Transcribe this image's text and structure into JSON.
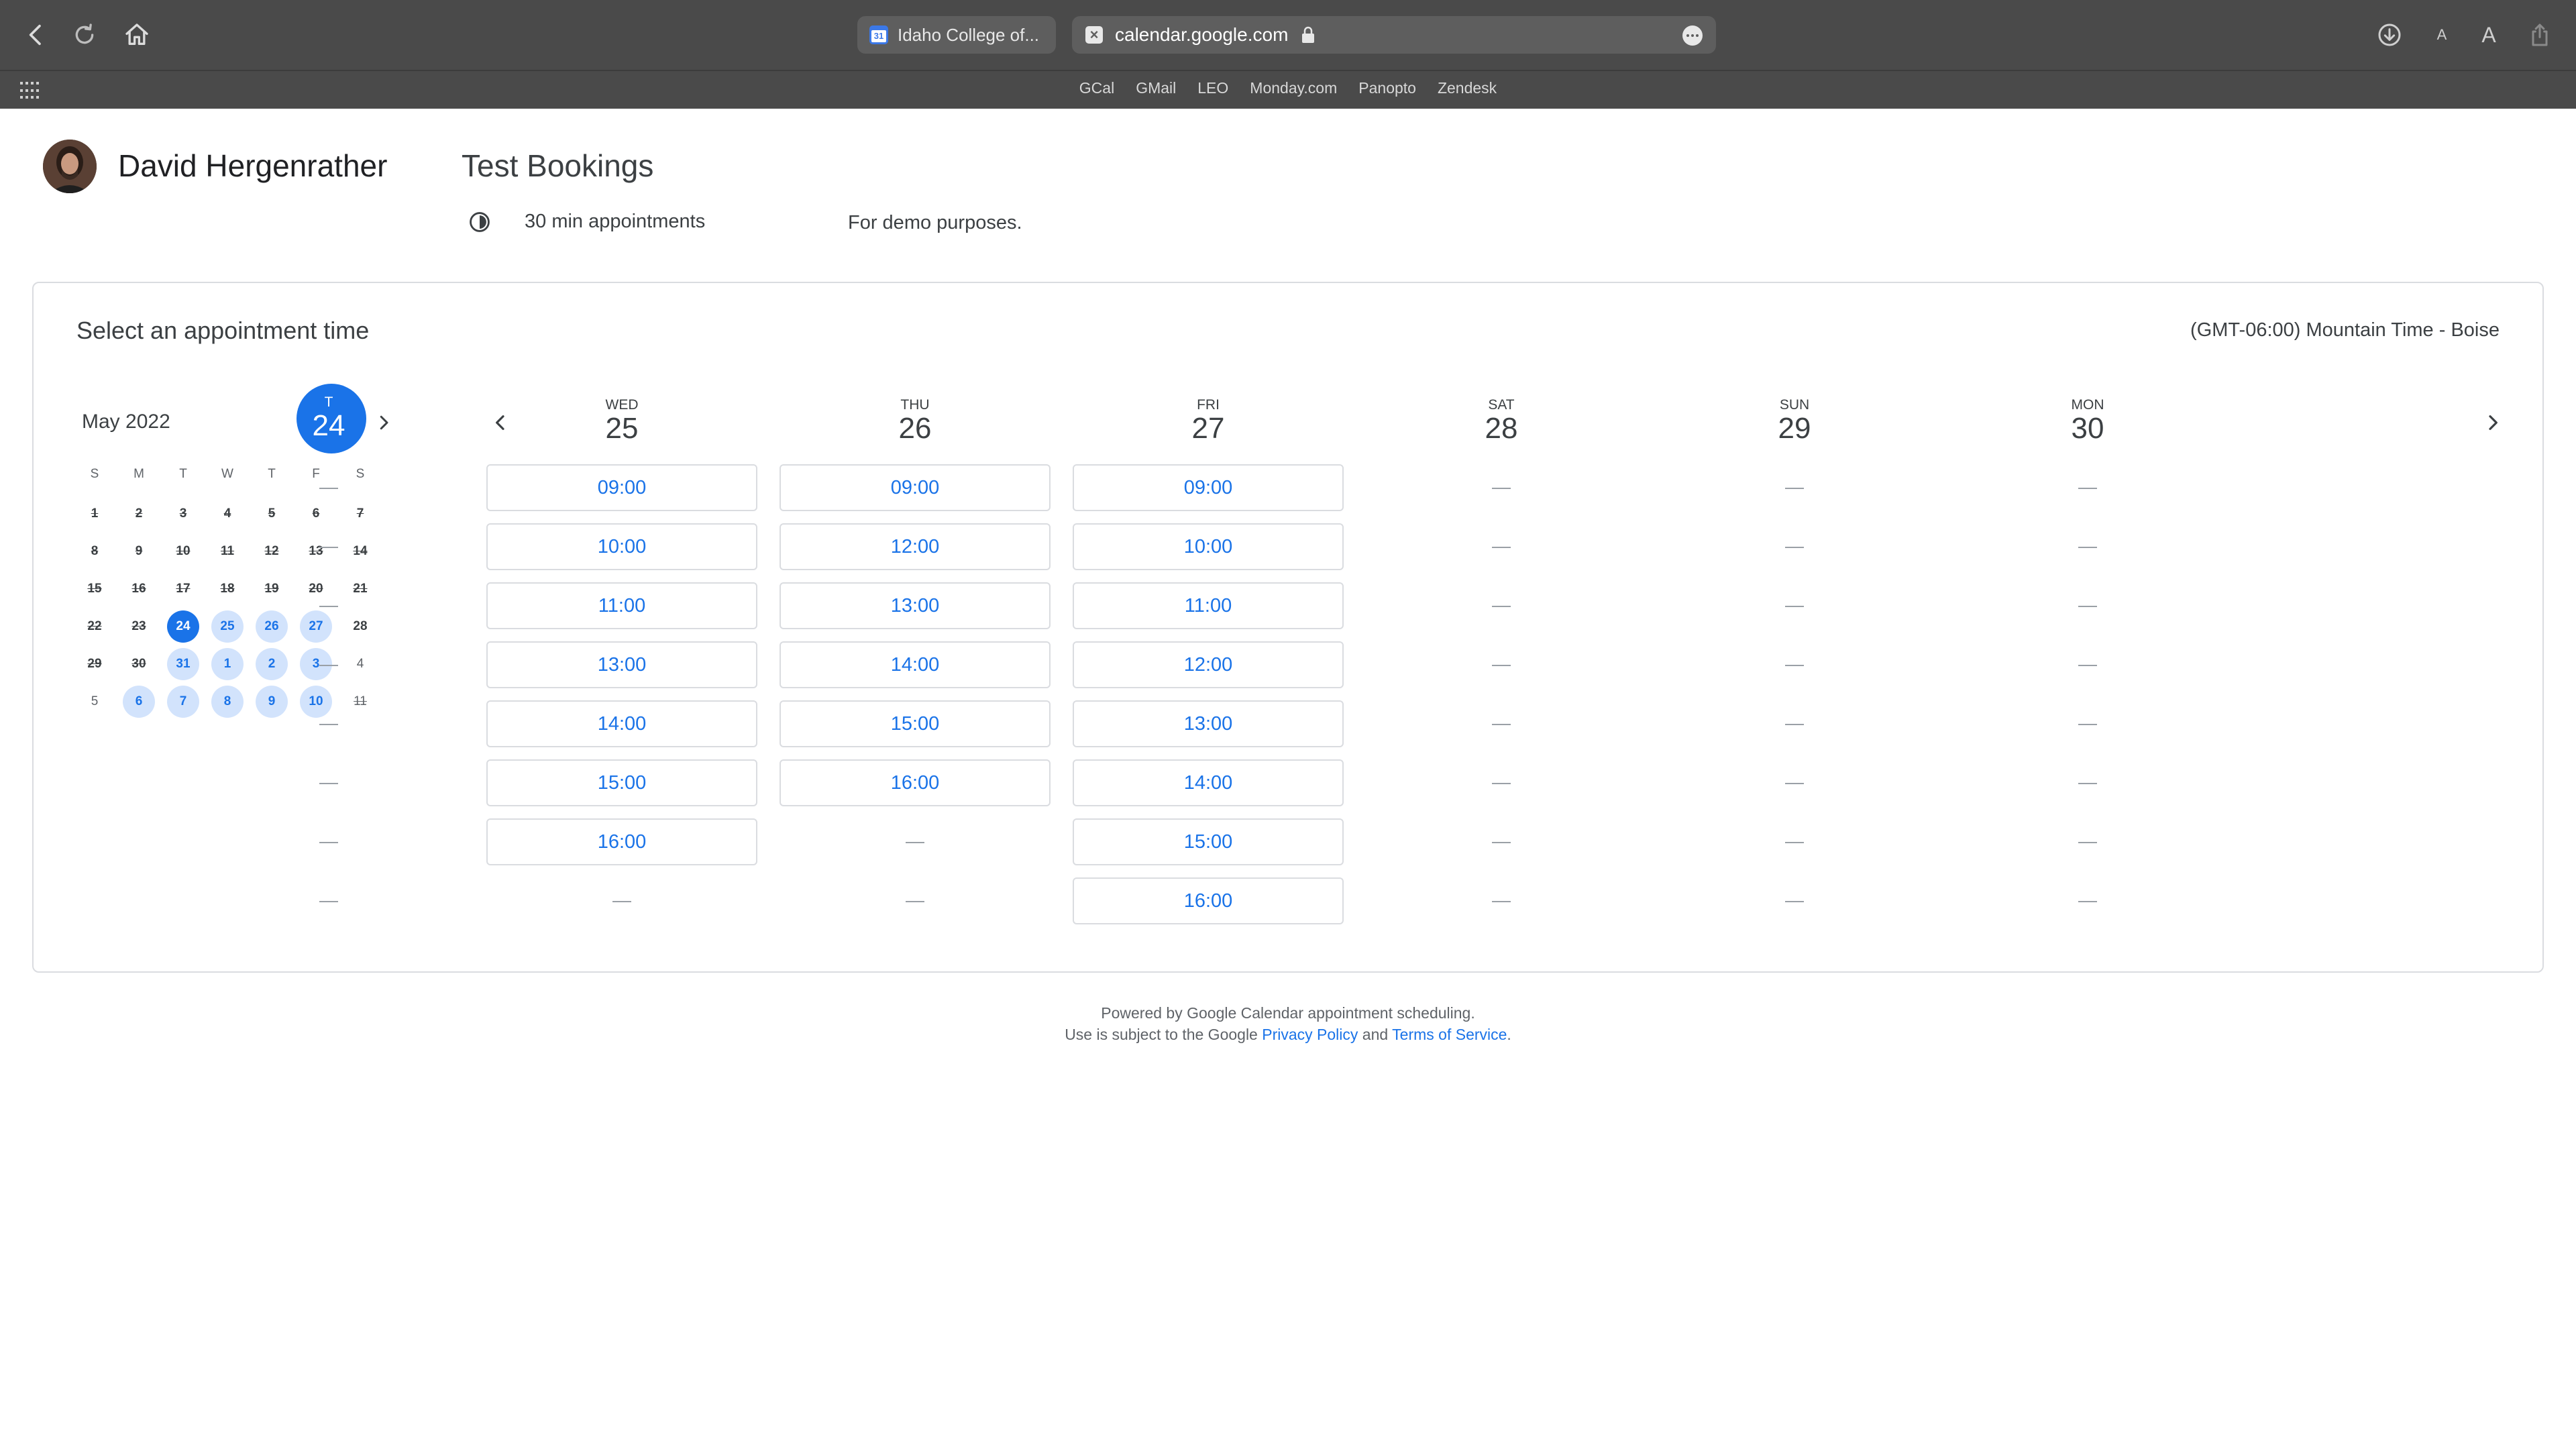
{
  "browser": {
    "tab_title": "Idaho College of...",
    "url": "calendar.google.com",
    "bookmarks": [
      "GCal",
      "GMail",
      "LEO",
      "Monday.com",
      "Panopto",
      "Zendesk"
    ],
    "font_small": "A",
    "font_large": "A"
  },
  "header": {
    "owner_name": "David Hergenrather",
    "booking_title": "Test Bookings",
    "duration": "30 min appointments",
    "description": "For demo purposes."
  },
  "panel": {
    "heading": "Select an appointment time",
    "timezone": "(GMT-06:00) Mountain Time - Boise"
  },
  "mini_calendar": {
    "month": "May 2022",
    "dow": [
      "S",
      "M",
      "T",
      "W",
      "T",
      "F",
      "S"
    ],
    "days": [
      {
        "n": "1",
        "s": "past"
      },
      {
        "n": "2",
        "s": "past"
      },
      {
        "n": "3",
        "s": "past"
      },
      {
        "n": "4",
        "s": "past"
      },
      {
        "n": "5",
        "s": "past"
      },
      {
        "n": "6",
        "s": "past"
      },
      {
        "n": "7",
        "s": "past"
      },
      {
        "n": "8",
        "s": "past"
      },
      {
        "n": "9",
        "s": "past"
      },
      {
        "n": "10",
        "s": "past"
      },
      {
        "n": "11",
        "s": "past"
      },
      {
        "n": "12",
        "s": "past"
      },
      {
        "n": "13",
        "s": "past"
      },
      {
        "n": "14",
        "s": "past"
      },
      {
        "n": "15",
        "s": "past"
      },
      {
        "n": "16",
        "s": "past"
      },
      {
        "n": "17",
        "s": "past"
      },
      {
        "n": "18",
        "s": "past"
      },
      {
        "n": "19",
        "s": "past"
      },
      {
        "n": "20",
        "s": "past"
      },
      {
        "n": "21",
        "s": "past"
      },
      {
        "n": "22",
        "s": "past"
      },
      {
        "n": "23",
        "s": "past"
      },
      {
        "n": "24",
        "s": "sel"
      },
      {
        "n": "25",
        "s": "avail"
      },
      {
        "n": "26",
        "s": "avail"
      },
      {
        "n": "27",
        "s": "avail"
      },
      {
        "n": "28",
        "s": "none"
      },
      {
        "n": "29",
        "s": "past"
      },
      {
        "n": "30",
        "s": "past"
      },
      {
        "n": "31",
        "s": "avail"
      },
      {
        "n": "1",
        "s": "avail"
      },
      {
        "n": "2",
        "s": "avail"
      },
      {
        "n": "3",
        "s": "avail"
      },
      {
        "n": "4",
        "s": "plain"
      },
      {
        "n": "5",
        "s": "plain"
      },
      {
        "n": "6",
        "s": "avail"
      },
      {
        "n": "7",
        "s": "avail"
      },
      {
        "n": "8",
        "s": "avail"
      },
      {
        "n": "9",
        "s": "avail"
      },
      {
        "n": "10",
        "s": "avail"
      },
      {
        "n": "11",
        "s": "plainpast"
      }
    ]
  },
  "week": {
    "days": [
      {
        "dow": "T",
        "num": "24",
        "today": true,
        "slots": [
          "",
          "",
          "",
          "",
          "",
          "",
          "",
          ""
        ]
      },
      {
        "dow": "WED",
        "num": "25",
        "today": false,
        "slots": [
          "09:00",
          "10:00",
          "11:00",
          "13:00",
          "14:00",
          "15:00",
          "16:00",
          ""
        ]
      },
      {
        "dow": "THU",
        "num": "26",
        "today": false,
        "slots": [
          "09:00",
          "12:00",
          "13:00",
          "14:00",
          "15:00",
          "16:00",
          "",
          ""
        ]
      },
      {
        "dow": "FRI",
        "num": "27",
        "today": false,
        "slots": [
          "09:00",
          "10:00",
          "11:00",
          "12:00",
          "13:00",
          "14:00",
          "15:00",
          "16:00"
        ]
      },
      {
        "dow": "SAT",
        "num": "28",
        "today": false,
        "slots": [
          "",
          "",
          "",
          "",
          "",
          "",
          "",
          ""
        ]
      },
      {
        "dow": "SUN",
        "num": "29",
        "today": false,
        "slots": [
          "",
          "",
          "",
          "",
          "",
          "",
          "",
          ""
        ]
      },
      {
        "dow": "MON",
        "num": "30",
        "today": false,
        "slots": [
          "",
          "",
          "",
          "",
          "",
          "",
          "",
          ""
        ]
      }
    ]
  },
  "footer": {
    "line1": "Powered by Google Calendar appointment scheduling.",
    "line2_prefix": "Use is subject to the Google",
    "privacy": "Privacy Policy",
    "and": "and",
    "terms": "Terms of Service",
    "period": "."
  },
  "colors": {
    "accent": "#1a73e8",
    "available_day": "#d2e3fc",
    "border": "#dadce0"
  }
}
